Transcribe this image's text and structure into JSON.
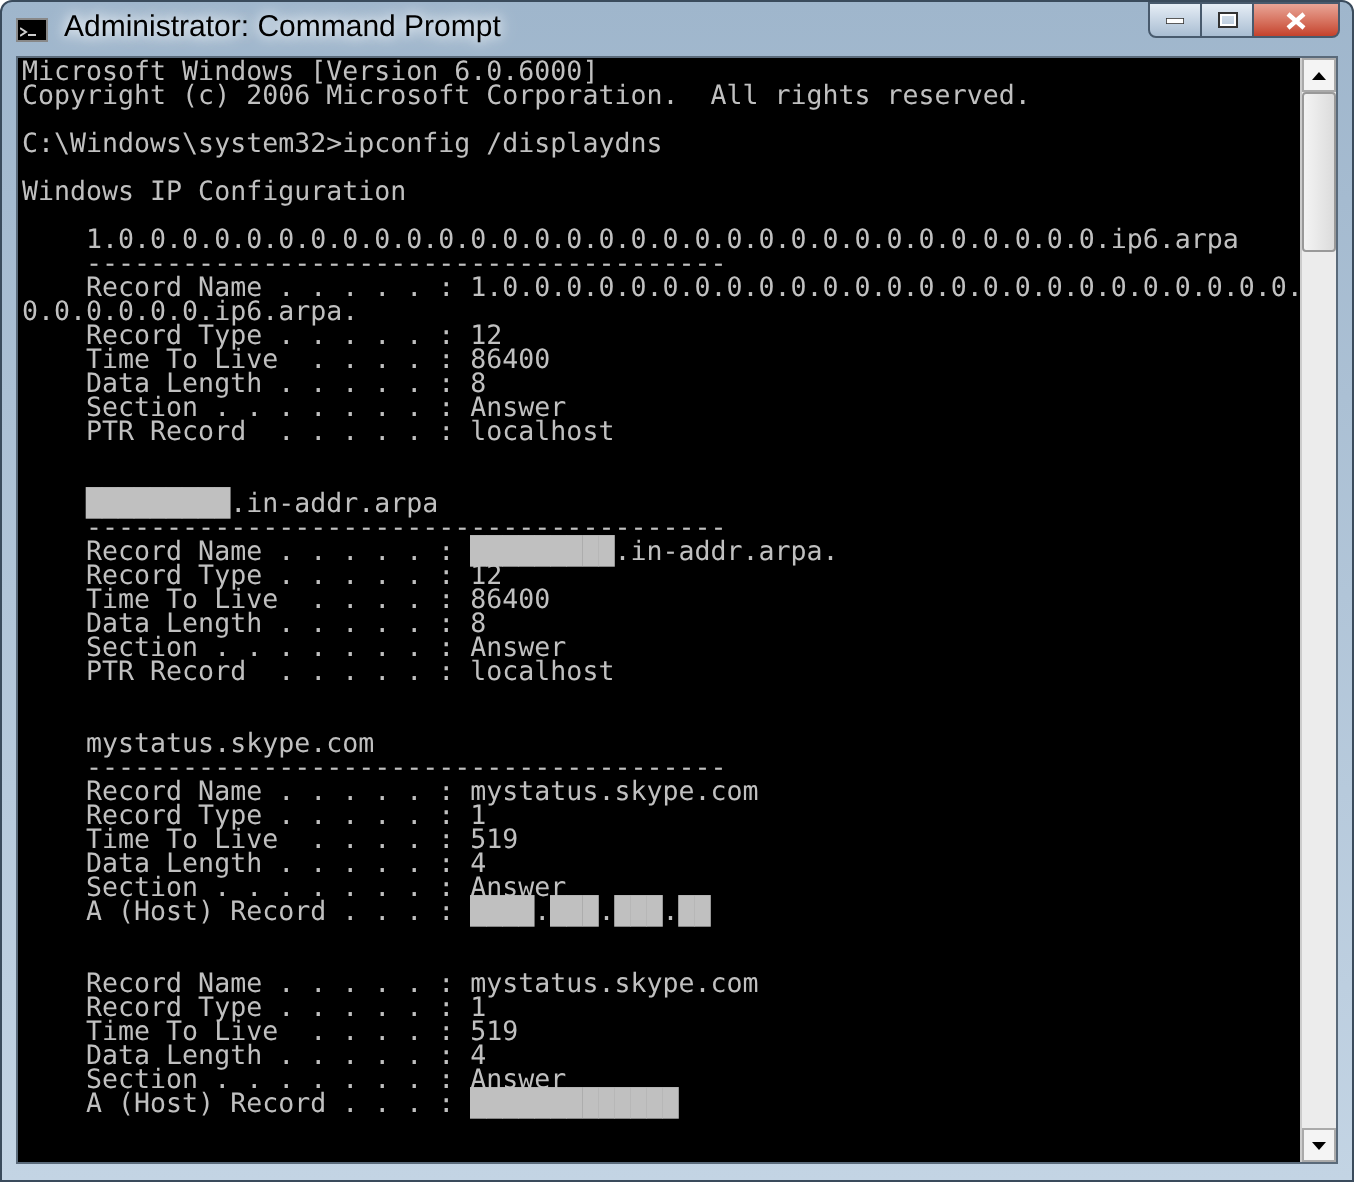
{
  "window": {
    "title": "Administrator: Command Prompt"
  },
  "console": {
    "lines": [
      {
        "kind": "text",
        "text": "Microsoft Windows [Version 6.0.6000]"
      },
      {
        "kind": "text",
        "text": "Copyright (c) 2006 Microsoft Corporation.  All rights reserved."
      },
      {
        "kind": "blank"
      },
      {
        "kind": "text",
        "text": "C:\\Windows\\system32>ipconfig /displaydns"
      },
      {
        "kind": "blank"
      },
      {
        "kind": "text",
        "text": "Windows IP Configuration"
      },
      {
        "kind": "blank"
      },
      {
        "kind": "text",
        "text": "    1.0.0.0.0.0.0.0.0.0.0.0.0.0.0.0.0.0.0.0.0.0.0.0.0.0.0.0.0.0.0.0.ip6.arpa"
      },
      {
        "kind": "text",
        "text": "    ----------------------------------------"
      },
      {
        "kind": "text",
        "text": "    Record Name . . . . . : 1.0.0.0.0.0.0.0.0.0.0.0.0.0.0.0.0.0.0.0.0.0.0.0.0.0."
      },
      {
        "kind": "text",
        "text": "0.0.0.0.0.0.ip6.arpa."
      },
      {
        "kind": "text",
        "text": "    Record Type . . . . . : 12"
      },
      {
        "kind": "text",
        "text": "    Time To Live  . . . . : 86400"
      },
      {
        "kind": "text",
        "text": "    Data Length . . . . . : 8"
      },
      {
        "kind": "text",
        "text": "    Section . . . . . . . : Answer"
      },
      {
        "kind": "text",
        "text": "    PTR Record  . . . . . : localhost"
      },
      {
        "kind": "blank"
      },
      {
        "kind": "blank"
      },
      {
        "kind": "text",
        "text": "    █████████.in-addr.arpa"
      },
      {
        "kind": "text",
        "text": "    ----------------------------------------"
      },
      {
        "kind": "text",
        "text": "    Record Name . . . . . : █████████.in-addr.arpa."
      },
      {
        "kind": "text",
        "text": "    Record Type . . . . . : 12"
      },
      {
        "kind": "text",
        "text": "    Time To Live  . . . . : 86400"
      },
      {
        "kind": "text",
        "text": "    Data Length . . . . . : 8"
      },
      {
        "kind": "text",
        "text": "    Section . . . . . . . : Answer"
      },
      {
        "kind": "text",
        "text": "    PTR Record  . . . . . : localhost"
      },
      {
        "kind": "blank"
      },
      {
        "kind": "blank"
      },
      {
        "kind": "text",
        "text": "    mystatus.skype.com"
      },
      {
        "kind": "text",
        "text": "    ----------------------------------------"
      },
      {
        "kind": "text",
        "text": "    Record Name . . . . . : mystatus.skype.com"
      },
      {
        "kind": "text",
        "text": "    Record Type . . . . . : 1"
      },
      {
        "kind": "text",
        "text": "    Time To Live  . . . . : 519"
      },
      {
        "kind": "text",
        "text": "    Data Length . . . . . : 4"
      },
      {
        "kind": "text",
        "text": "    Section . . . . . . . : Answer"
      },
      {
        "kind": "text",
        "text": "    A (Host) Record . . . : ████.███.███.██"
      },
      {
        "kind": "blank"
      },
      {
        "kind": "blank"
      },
      {
        "kind": "text",
        "text": "    Record Name . . . . . : mystatus.skype.com"
      },
      {
        "kind": "text",
        "text": "    Record Type . . . . . : 1"
      },
      {
        "kind": "text",
        "text": "    Time To Live  . . . . : 519"
      },
      {
        "kind": "text",
        "text": "    Data Length . . . . . : 4"
      },
      {
        "kind": "text",
        "text": "    Section . . . . . . . : Answer"
      },
      {
        "kind": "text",
        "text": "    A (Host) Record . . . : █████████████"
      }
    ]
  }
}
